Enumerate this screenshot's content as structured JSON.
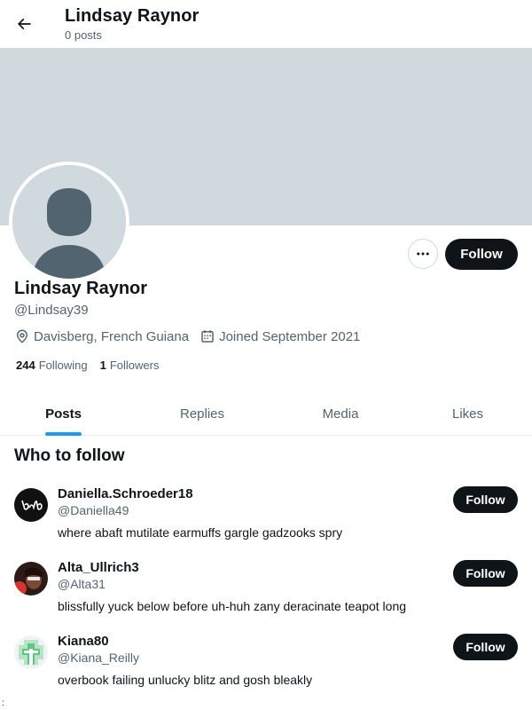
{
  "header": {
    "title": "Lindsay Raynor",
    "post_count": "0 posts"
  },
  "profile": {
    "display_name": "Lindsay Raynor",
    "handle": "@Lindsay39",
    "location": "Davisberg, French Guiana",
    "joined": "Joined September 2021",
    "following_count": "244",
    "following_label": "Following",
    "followers_count": "1",
    "followers_label": "Followers",
    "follow_label": "Follow"
  },
  "tabs": [
    {
      "label": "Posts",
      "active": true
    },
    {
      "label": "Replies",
      "active": false
    },
    {
      "label": "Media",
      "active": false
    },
    {
      "label": "Likes",
      "active": false
    }
  ],
  "who_to_follow": {
    "title": "Who to follow",
    "users": [
      {
        "name": "Daniella.Schroeder18",
        "handle": "@Daniella49",
        "bio": "where abaft mutilate earmuffs gargle gadzooks spry",
        "follow_label": "Follow"
      },
      {
        "name": "Alta_Ullrich3",
        "handle": "@Alta31",
        "bio": "blissfully yuck below before uh-huh zany deracinate teapot long",
        "follow_label": "Follow"
      },
      {
        "name": "Kiana80",
        "handle": "@Kiana_Reilly",
        "bio": "overbook failing unlucky blitz and gosh bleakly",
        "follow_label": "Follow"
      }
    ]
  },
  "footer_mark": ":",
  "colors": {
    "accent": "#1d9bf0",
    "text": "#0f1419",
    "muted": "#536471",
    "banner": "#cfd9de"
  }
}
